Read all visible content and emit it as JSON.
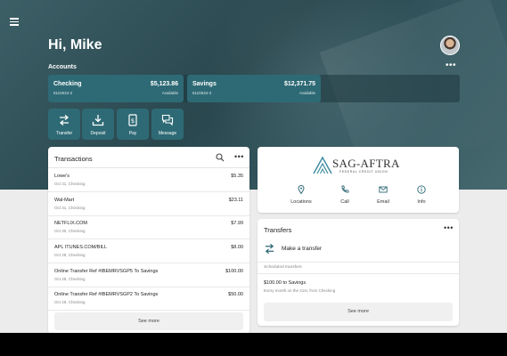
{
  "header": {
    "greeting": "Hi, Mike"
  },
  "accounts": {
    "label": "Accounts",
    "items": [
      {
        "name": "Checking",
        "number": "6110634-2",
        "balance": "$5,123.86",
        "available_label": "Available"
      },
      {
        "name": "Savings",
        "number": "6110634-3",
        "balance": "$12,371.75",
        "available_label": "Available"
      }
    ]
  },
  "actions": [
    {
      "label": "Transfer",
      "icon": "transfer-icon"
    },
    {
      "label": "Deposit",
      "icon": "deposit-icon"
    },
    {
      "label": "Pay",
      "icon": "pay-icon"
    },
    {
      "label": "Message",
      "icon": "message-icon"
    }
  ],
  "transactions": {
    "title": "Transactions",
    "rows": [
      {
        "desc": "Lowe's",
        "amount": "$5.35",
        "sub": "Oct 31, Checking"
      },
      {
        "desc": "Wal-Mart",
        "amount": "$23.11",
        "sub": "Oct 31, Checking"
      },
      {
        "desc": "NETFLIX.COM",
        "amount": "$7.99",
        "sub": "Oct 30, Checking"
      },
      {
        "desc": "APL ITUNES.COM/BILL",
        "amount": "$8.00",
        "sub": "Oct 29, Checking"
      },
      {
        "desc": "Online Transfer Ref #IBEMRVSGP5 To Savings",
        "amount": "$100.00",
        "sub": "Oct 29, Checking"
      },
      {
        "desc": "Online Transfer Ref #IBEMRVSGP2 To Savings",
        "amount": "$50.00",
        "sub": "Oct 29, Checking"
      }
    ],
    "see_more": "See more"
  },
  "credit_union": {
    "name": "SAG-AFTRA",
    "subname": "FEDERAL CREDIT UNION",
    "buttons": [
      {
        "label": "Locations",
        "icon": "location-pin-icon"
      },
      {
        "label": "Call",
        "icon": "phone-icon"
      },
      {
        "label": "Email",
        "icon": "email-icon"
      },
      {
        "label": "Info",
        "icon": "info-icon"
      }
    ]
  },
  "transfers": {
    "title": "Transfers",
    "make_transfer": "Make a transfer",
    "scheduled_label": "Scheduled transfers",
    "scheduled": [
      {
        "title": "$100.00 to Savings",
        "sub": "Every month on the 21st, from Checking"
      }
    ],
    "see_more": "See more"
  },
  "colors": {
    "accent": "#2e6a75",
    "hero_bg": "#2f4d54",
    "background": "#ececec"
  }
}
